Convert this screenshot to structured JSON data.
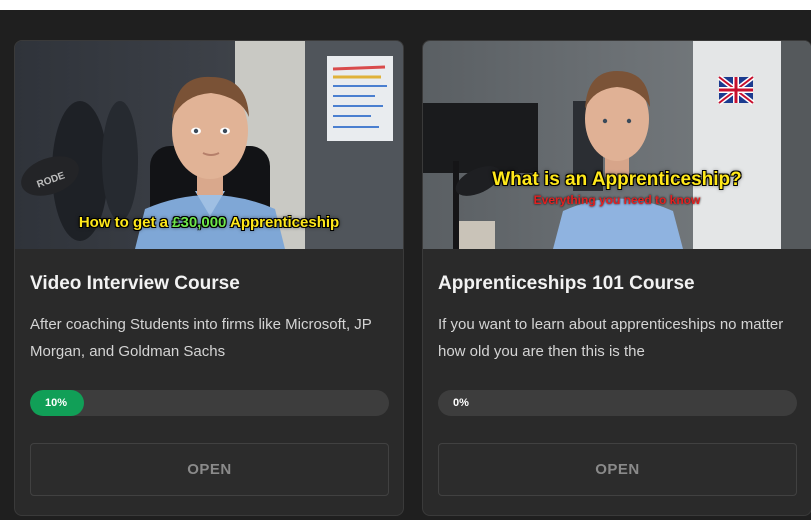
{
  "courses": [
    {
      "thumbnail": {
        "caption_before": "How to get a ",
        "caption_highlight": "£30,000",
        "caption_after": " Apprenticeship",
        "mic_text": "RODE"
      },
      "title": "Video Interview Course",
      "description": "After coaching Students into firms like Microsoft, JP Morgan, and Goldman Sachs",
      "progress_percent": 10,
      "progress_label": "10%",
      "button_label": "OPEN"
    },
    {
      "thumbnail": {
        "caption": "What is an Apprenticeship?",
        "subcaption": "Everything you need to know"
      },
      "title": "Apprenticeships 101 Course",
      "description": "If you want to learn about apprenticeships no matter how old you are then this is the",
      "progress_percent": 0,
      "progress_label": "0%",
      "button_label": "OPEN"
    }
  ],
  "colors": {
    "background": "#1f1f1f",
    "card": "#2a2a2a",
    "progress_fill": "#119f57",
    "progress_track": "#3d3d3d"
  }
}
